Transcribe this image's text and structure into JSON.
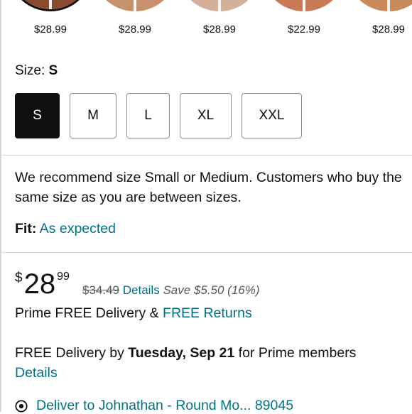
{
  "swatches": [
    {
      "price": "$28.99",
      "color": "#8a4a2e"
    },
    {
      "price": "$28.99",
      "color": "#c8916e"
    },
    {
      "price": "$28.99",
      "color": "#d2b09a"
    },
    {
      "price": "$22.99",
      "color": "#c77a55"
    },
    {
      "price": "$28.99",
      "color": "#c88a5a"
    }
  ],
  "size": {
    "label": "Size:",
    "selected": "S",
    "options": [
      "S",
      "M",
      "L",
      "XL",
      "XXL"
    ]
  },
  "recommendation": "We recommend size Small or Medium. Customers who buy the same size as you are between sizes.",
  "fit": {
    "label": "Fit:",
    "value": "As expected"
  },
  "price": {
    "currency": "$",
    "whole": "28",
    "fraction": "99",
    "list_price": "$34.49",
    "details_link": "Details",
    "savings": "Save $5.50 (16%)"
  },
  "prime": {
    "text": "Prime FREE Delivery &",
    "returns_link": "FREE Returns"
  },
  "delivery": {
    "prefix": "FREE Delivery by",
    "date": "Tuesday, Sep 21",
    "suffix": "for Prime members",
    "details_link": "Details"
  },
  "deliver_to": "Deliver to Johnathan - Round Mo... 89045",
  "colors": {
    "link": "#007185",
    "selected": "#0f1111",
    "divider": "#d5d9d9"
  }
}
